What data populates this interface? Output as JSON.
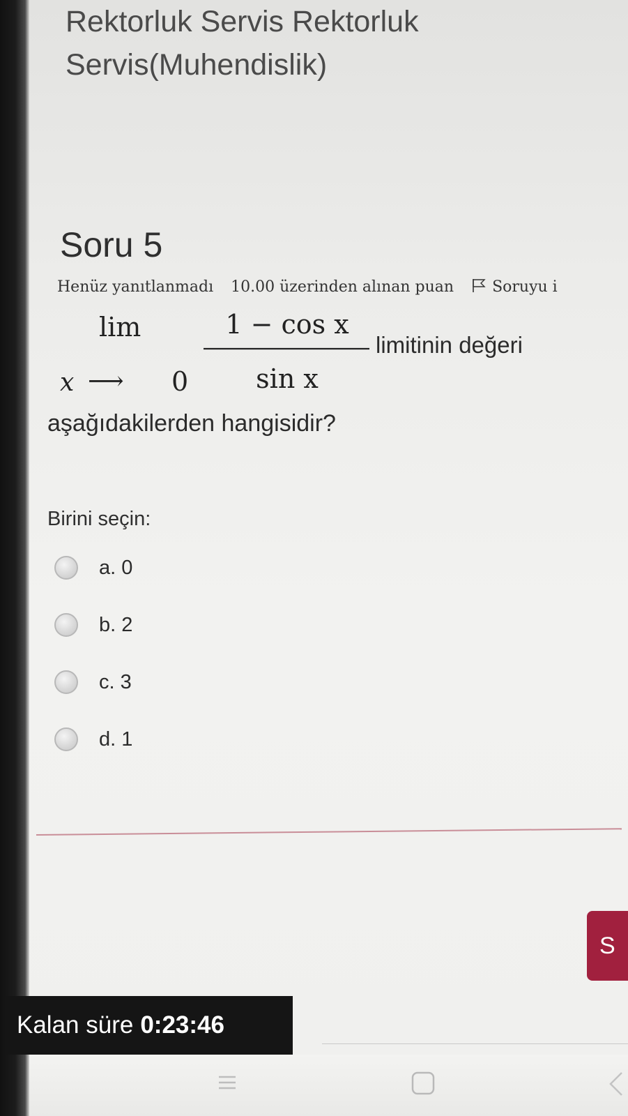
{
  "course": {
    "title": "Rektorluk Servis Rektorluk Servis(Muhendislik)"
  },
  "question": {
    "heading": "Soru 5",
    "status": "Henüz yanıtlanmadı",
    "points": "10.00 üzerinden alınan puan",
    "flag_label": "Soruyu i",
    "math": {
      "lim": "lim",
      "variable": "x",
      "arrow": "⟶",
      "limit_point": "0",
      "numerator": "1 − cos x",
      "denominator": "sin x"
    },
    "text_after_math": "limitinin değeri",
    "text_tail": "aşağıdakilerden hangisidir?"
  },
  "answer": {
    "prompt": "Birini seçin:",
    "options": [
      {
        "label": "a. 0"
      },
      {
        "label": "b. 2"
      },
      {
        "label": "c. 3"
      },
      {
        "label": "d. 1"
      }
    ]
  },
  "navigation": {
    "next_button_label": "S"
  },
  "timer": {
    "label": "Kalan süre",
    "value": "0:23:46"
  },
  "colors": {
    "accent": "#a1203e",
    "timer_bg": "#151515",
    "divider": "#c98e98"
  },
  "icons": {
    "flag": "flag-icon",
    "recents": "recents-icon",
    "home": "home-icon",
    "back": "back-icon"
  }
}
